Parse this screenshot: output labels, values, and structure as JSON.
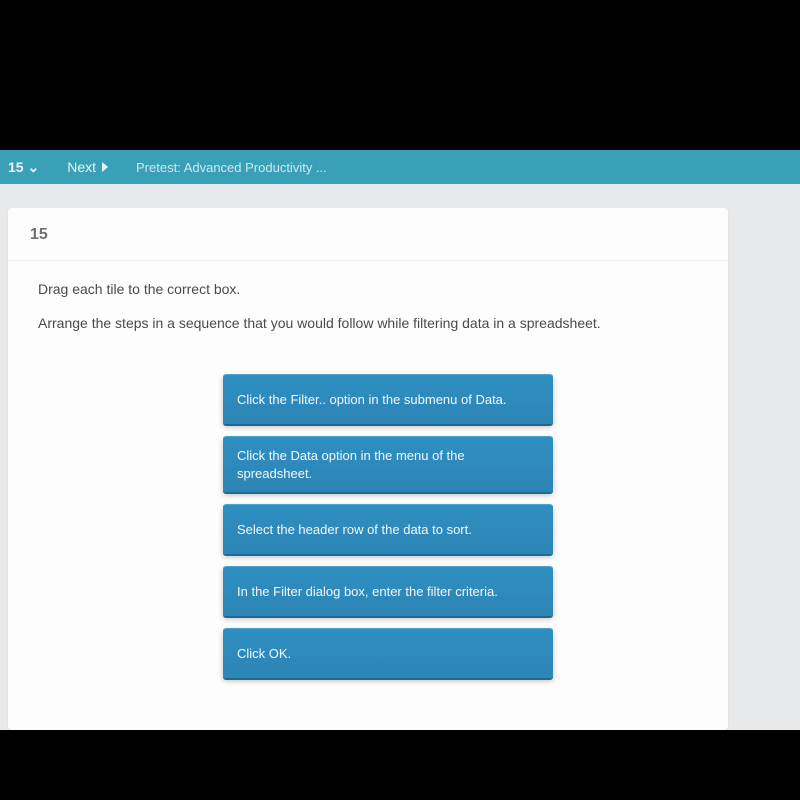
{
  "nav": {
    "counter": "15 ⌄",
    "next_label": "Next",
    "title": "Pretest: Advanced Productivity ..."
  },
  "question": {
    "number": "15",
    "instruction": "Drag each tile to the correct box.",
    "prompt": "Arrange the steps in a sequence that you would follow while filtering data in a spreadsheet."
  },
  "tiles": [
    {
      "label": "Click the Filter.. option in the submenu of Data."
    },
    {
      "label": "Click the Data option in the menu of the spreadsheet."
    },
    {
      "label": "Select the header row of the data to sort."
    },
    {
      "label": "In the Filter dialog box, enter the filter criteria."
    },
    {
      "label": "Click OK."
    }
  ]
}
